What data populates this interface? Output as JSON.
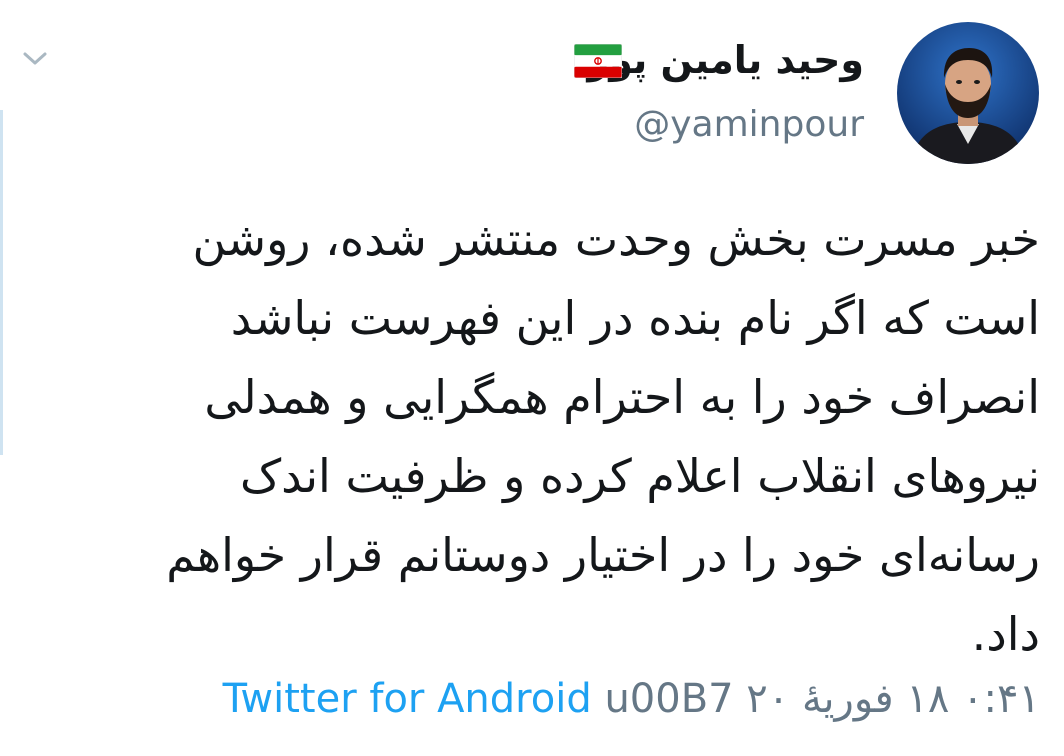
{
  "user": {
    "display_name": "وحید یامین پور",
    "handle": "@yaminpour",
    "flag_icon": "iran-flag-icon"
  },
  "tweet": {
    "text": "خبر مسرت بخش وحدت منتشر شده، روشن\nاست که اگر نام بنده در این فهرست نباشد\nانصراف خود را به احترام همگرایی و همدلی\nنیروهای انقلاب اعلام کرده و ظرفیت اندک\nرسانه‌ای خود را در اختیار دوستانم قرار خواهم\nداد."
  },
  "meta": {
    "time": "۰:۴۱",
    "date": "۱۸ فوریهٔ ۲۰",
    "separator": "u00B7",
    "source": "Twitter for Android"
  },
  "colors": {
    "text": "#14171a",
    "secondary": "#657786",
    "link": "#1da1f2",
    "flag_green": "#239f40",
    "flag_red": "#da0000"
  },
  "icons": {
    "menu": "chevron-down-icon"
  }
}
